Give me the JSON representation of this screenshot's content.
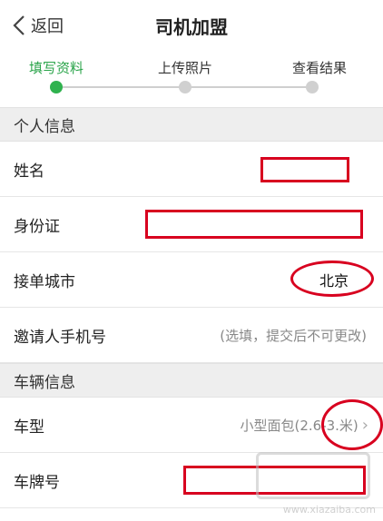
{
  "nav": {
    "back_label": "返回",
    "title": "司机加盟"
  },
  "steps": [
    {
      "label": "填写资料",
      "active": true
    },
    {
      "label": "上传照片",
      "active": false
    },
    {
      "label": "查看结果",
      "active": false
    }
  ],
  "personal": {
    "header": "个人信息",
    "name_label": "姓名",
    "id_label": "身份证",
    "city_label": "接单城市",
    "city_value": "北京",
    "inviter_label": "邀请人手机号",
    "inviter_placeholder": "(选填，提交后不可更改)"
  },
  "vehicle": {
    "header": "车辆信息",
    "type_label": "车型",
    "type_value": "小型面包(2.6-3.米)",
    "plate_label": "车牌号"
  },
  "watermark": "www.xiazaiba.com",
  "colors": {
    "accent": "#2fb24e",
    "annotation": "#d8001f"
  }
}
